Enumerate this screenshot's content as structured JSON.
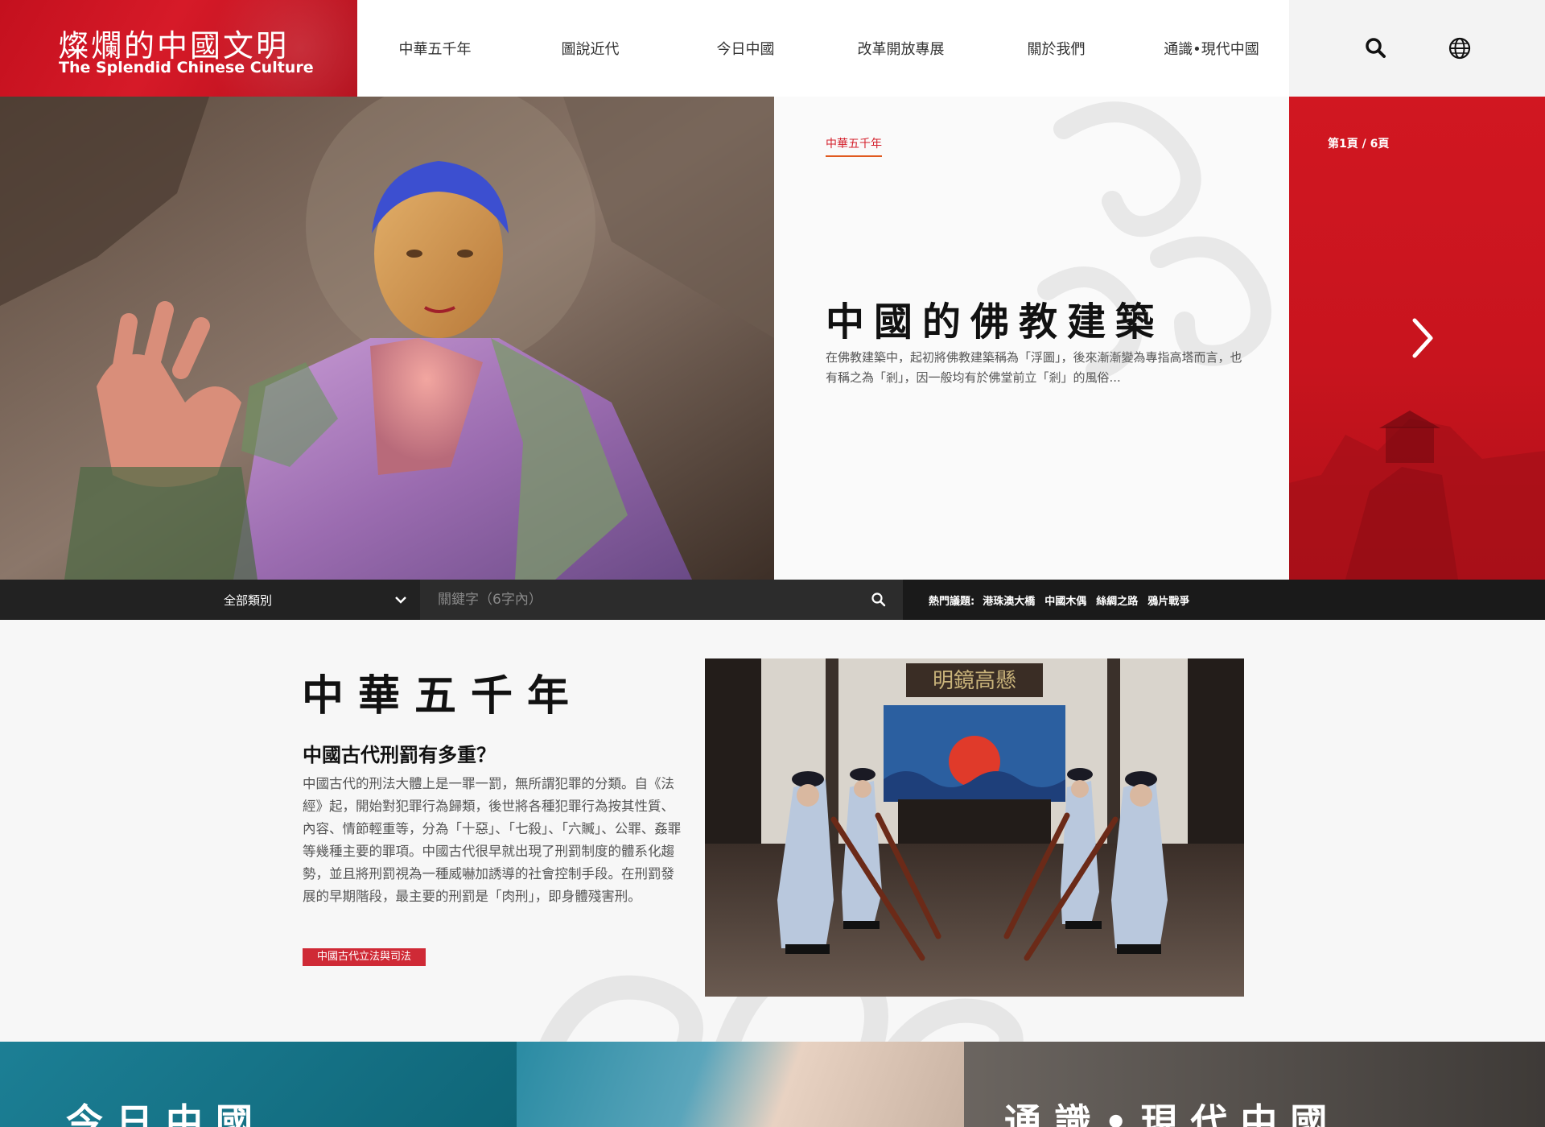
{
  "brand": {
    "title_cn": "燦爛的中國文明",
    "title_en": "The Splendid Chinese Culture"
  },
  "nav": {
    "items": [
      {
        "label": "中華五千年"
      },
      {
        "label": "圖說近代"
      },
      {
        "label": "今日中國"
      },
      {
        "label": "改革開放專展"
      },
      {
        "label": "關於我們"
      },
      {
        "label": "通識•現代中國"
      }
    ]
  },
  "hero": {
    "category": "中華五千年",
    "title": "中國的佛教建築",
    "description": "在佛教建築中，起初將佛教建築稱為「浮圖」，後來漸漸變為專指高塔而言，也有稱之為「剎」，因一般均有於佛堂前立「剎」的風俗...",
    "page_indicator": "第1頁 / 6頁"
  },
  "search": {
    "category_label": "全部類別",
    "keyword_placeholder": "關鍵字（6字內）",
    "hot_label": "熱門議題:",
    "hot_topics": [
      "港珠澳大橋",
      "中國木偶",
      "絲綢之路",
      "鴉片戰爭"
    ]
  },
  "section": {
    "title": "中華五千年",
    "article_title": "中國古代刑罰有多重？",
    "article_body": "中國古代的刑法大體上是一罪一罰，無所謂犯罪的分類。自《法經》起，開始對犯罪行為歸類，後世將各種犯罪行為按其性質、內容、情節輕重等，分為「十惡」、「七殺」、「六贓」、公罪、姦罪等幾種主要的罪項。中國古代很早就出現了刑罰制度的體系化趨勢，並且將刑罰視為一種威嚇加誘導的社會控制手段。在刑罰發展的早期階段，最主要的刑罰是「肉刑」，即身體殘害刑。",
    "tag": "中國古代立法與司法",
    "board_text": "明鏡高懸"
  },
  "bottom": {
    "left_title": "今日中國",
    "right_title": "通識•現代中國"
  },
  "colors": {
    "brand_red": "#c8141e",
    "tag_red": "#cf2a36",
    "teal": "#1c7f95"
  }
}
